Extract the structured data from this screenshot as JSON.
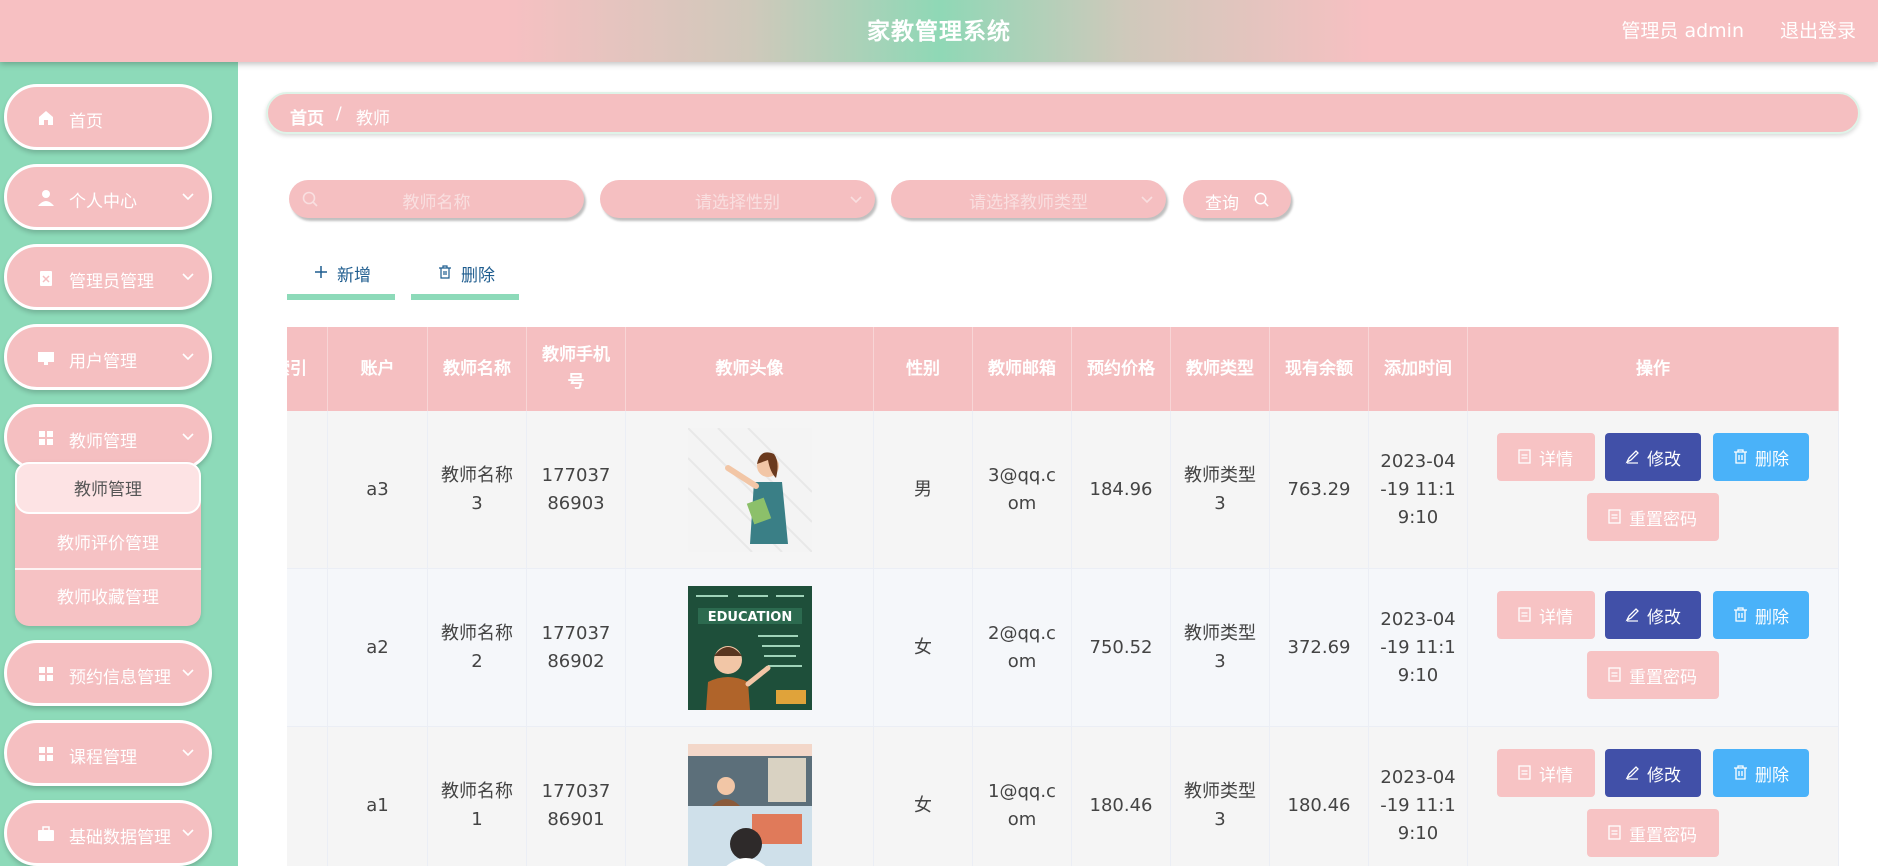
{
  "header": {
    "title": "家教管理系统",
    "user_label": "管理员 admin",
    "logout_label": "退出登录"
  },
  "sidebar": {
    "items": [
      {
        "label": "首页",
        "icon": "home-icon"
      },
      {
        "label": "个人中心",
        "icon": "user-icon"
      },
      {
        "label": "管理员管理",
        "icon": "clipboard-icon"
      },
      {
        "label": "用户管理",
        "icon": "monitor-icon"
      },
      {
        "label": "教师管理",
        "icon": "grid-icon"
      },
      {
        "label": "预约信息管理",
        "icon": "grid-icon"
      },
      {
        "label": "课程管理",
        "icon": "grid-icon"
      },
      {
        "label": "基础数据管理",
        "icon": "briefcase-icon"
      }
    ],
    "submenu": [
      {
        "label": "教师管理",
        "active": true
      },
      {
        "label": "教师评价管理",
        "active": false
      },
      {
        "label": "教师收藏管理",
        "active": false
      }
    ]
  },
  "breadcrumb": {
    "home": "首页",
    "separator": "/",
    "current": "教师"
  },
  "search": {
    "name_placeholder": "教师名称",
    "gender_placeholder": "请选择性别",
    "type_placeholder": "请选择教师类型",
    "query_label": "查询"
  },
  "actions": {
    "add_label": "新增",
    "delete_label": "删除"
  },
  "table": {
    "columns": [
      "索引",
      "账户",
      "教师名称",
      "教师手机号",
      "教师头像",
      "性别",
      "教师邮箱",
      "预约价格",
      "教师类型",
      "现有余额",
      "添加时间",
      "操作"
    ],
    "rows": [
      {
        "account": "a3",
        "name": "教师名称3",
        "phone": "17703786903",
        "avatar": "teacher-pointing-avatar",
        "gender": "男",
        "email": "3@qq.com",
        "price": "184.96",
        "type": "教师类型3",
        "balance": "763.29",
        "time": "2023-04-19 11:19:10"
      },
      {
        "account": "a2",
        "name": "教师名称2",
        "phone": "17703786902",
        "avatar": "education-chalkboard-avatar",
        "gender": "女",
        "email": "2@qq.com",
        "price": "750.52",
        "type": "教师类型3",
        "balance": "372.69",
        "time": "2023-04-19 11:19:10"
      },
      {
        "account": "a1",
        "name": "教师名称1",
        "phone": "17703786901",
        "avatar": "classroom-teacher-avatar",
        "gender": "女",
        "email": "1@qq.com",
        "price": "180.46",
        "type": "教师类型3",
        "balance": "180.46",
        "time": "2023-04-19 11:19:10"
      }
    ],
    "ops": {
      "detail": "详情",
      "edit": "修改",
      "delete": "删除",
      "reset": "重置密码"
    }
  },
  "colors": {
    "pink": "#f5bfc1",
    "green": "#8ddab9",
    "indigo": "#4150a8",
    "sky": "#4ab2f9"
  }
}
